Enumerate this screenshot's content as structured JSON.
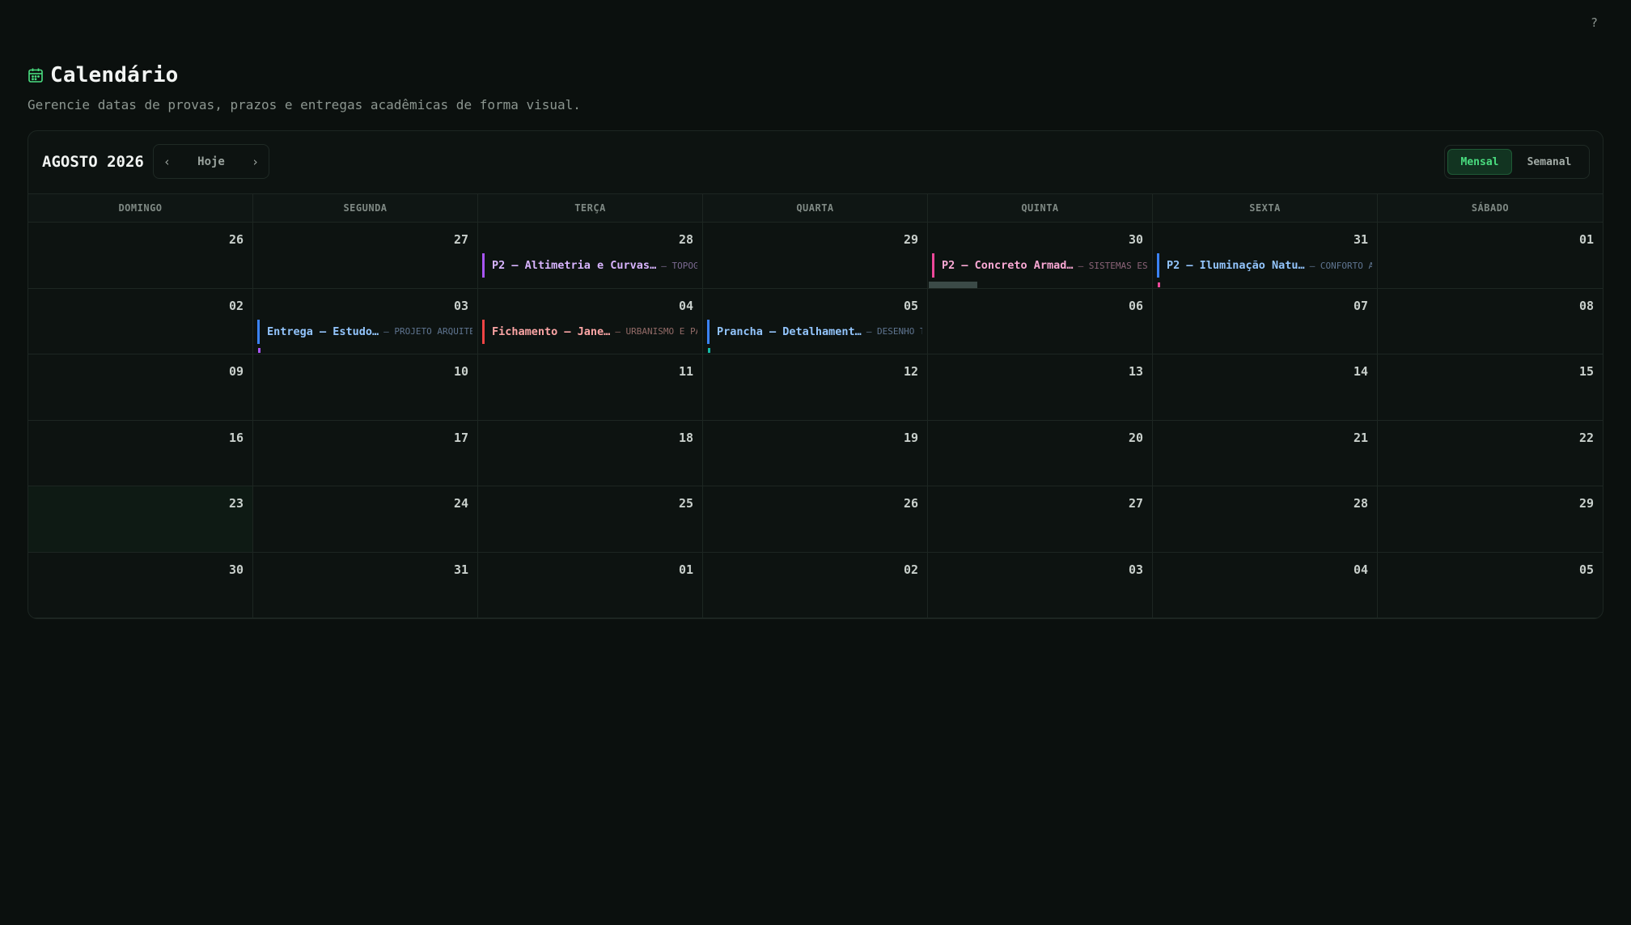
{
  "help": "?",
  "header": {
    "title": "Calendário",
    "subtitle": "Gerencie datas de provas, prazos e entregas acadêmicas de forma visual."
  },
  "toolbar": {
    "month": "AGOSTO 2026",
    "today": "Hoje",
    "views": [
      "Mensal",
      "Semanal"
    ],
    "active_view": "Mensal"
  },
  "weekdays": [
    "DOMINGO",
    "SEGUNDA",
    "TERÇA",
    "QUARTA",
    "QUINTA",
    "SEXTA",
    "SÁBADO"
  ],
  "days": [
    "26",
    "27",
    "28",
    "29",
    "30",
    "31",
    "01",
    "02",
    "03",
    "04",
    "05",
    "06",
    "07",
    "08",
    "09",
    "10",
    "11",
    "12",
    "13",
    "14",
    "15",
    "16",
    "17",
    "18",
    "19",
    "20",
    "21",
    "22",
    "23",
    "24",
    "25",
    "26",
    "27",
    "28",
    "29",
    "30",
    "31",
    "01",
    "02",
    "03",
    "04",
    "05"
  ],
  "today_index": 28,
  "events": [
    {
      "cell": 2,
      "title": "P2 — Altimetria e Curvas…",
      "subject": "— TOPOGR…",
      "color": "#a855f7",
      "text": "#d8b4fe",
      "sub": "#8f7aa8"
    },
    {
      "cell": 4,
      "title": "P2 — Concreto Armad…",
      "subject": "— SISTEMAS ES…",
      "color": "#ec4899",
      "text": "#f9a8d4",
      "sub": "#a1728a"
    },
    {
      "cell": 5,
      "title": "P2 — Iluminação Natu…",
      "subject": "— CONFORTO A…",
      "color": "#3b82f6",
      "text": "#93c5fd",
      "sub": "#6d85a6"
    },
    {
      "cell": 8,
      "title": "Entrega — Estudo…",
      "subject": "— PROJETO ARQUITE…",
      "color": "#3b82f6",
      "text": "#93c5fd",
      "sub": "#6d85a6"
    },
    {
      "cell": 9,
      "title": "Fichamento — Jane…",
      "subject": "— URBANISMO E PAI…",
      "color": "#ef4444",
      "text": "#fca5a5",
      "sub": "#a97a76"
    },
    {
      "cell": 10,
      "title": "Prancha — Detalhament…",
      "subject": "— DESENHO T…",
      "color": "#3b82f6",
      "text": "#93c5fd",
      "sub": "#6d85a6"
    }
  ],
  "colors": {
    "accent": "#4ade80",
    "background": "#0b100e"
  }
}
